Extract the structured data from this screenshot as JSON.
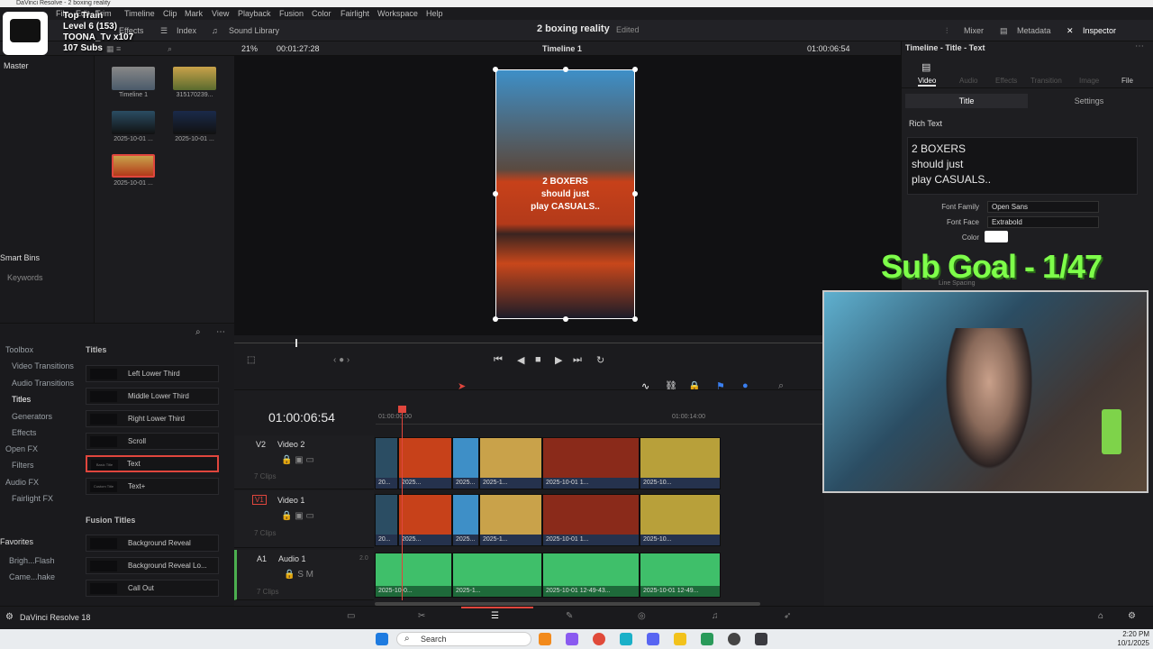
{
  "window_title": "DaVinci Resolve - 2 boxing reality",
  "menu": [
    "File",
    "Edit",
    "Trim",
    "Timeline",
    "Clip",
    "Mark",
    "View",
    "Playback",
    "Fusion",
    "Color",
    "Fairlight",
    "Workspace",
    "Help"
  ],
  "toolbar": {
    "effects": "Effects",
    "index": "Index",
    "sound_library": "Sound Library",
    "project_name": "2 boxing reality",
    "edited": "Edited",
    "mixer": "Mixer",
    "metadata": "Metadata",
    "inspector": "Inspector"
  },
  "subbar": {
    "zoom": "21%",
    "source_tc": "00:01:27:28",
    "timeline_name": "Timeline 1",
    "record_tc": "01:00:06:54"
  },
  "media": {
    "master": "Master",
    "smart_bins": "Smart Bins",
    "keywords": "Keywords",
    "clips": [
      {
        "label": "Timeline 1"
      },
      {
        "label": "315170239..."
      },
      {
        "label": "2025-10-01 ..."
      },
      {
        "label": "2025-10-01 ..."
      },
      {
        "label": "2025-10-01 ..."
      }
    ]
  },
  "viewer": {
    "overlay_text": [
      "2 BOXERS",
      "should just",
      "play CASUALS.."
    ]
  },
  "effects_lib": {
    "categories": [
      "Toolbox",
      "Video Transitions",
      "Audio Transitions",
      "Titles",
      "Generators",
      "Effects",
      "Open FX",
      "Filters",
      "Audio FX",
      "Fairlight FX",
      "Favorites",
      "Brigh...Flash",
      "Came...hake"
    ],
    "titles_header": "Titles",
    "titles": [
      "Left Lower Third",
      "Middle Lower Third",
      "Right Lower Third",
      "Scroll",
      "Text",
      "Text+"
    ],
    "title_thumbs": [
      "",
      "",
      "",
      "",
      "Basic Title",
      "Custom Title"
    ],
    "fusion_header": "Fusion Titles",
    "fusion": [
      "Background Reveal",
      "Background Reveal Lo...",
      "Call Out"
    ]
  },
  "timeline": {
    "timecode": "01:00:06:54",
    "ruler_start": "01:00:00:00",
    "ruler_mid": "01:00:14:00",
    "tracks": [
      {
        "id": "V2",
        "name": "Video 2",
        "clips": "7 Clips"
      },
      {
        "id": "V1",
        "name": "Video 1",
        "clips": "7 Clips"
      },
      {
        "id": "A1",
        "name": "Audio 1",
        "clips": "7 Clips",
        "level": "2.0"
      }
    ],
    "v_clip_labels": [
      "20...",
      "2025...",
      "2025...",
      "2025-1...",
      "2025-10-01 1...",
      "2025-10..."
    ],
    "a_clip_labels": [
      "2025-10-0...",
      "2025-1...",
      "2025-10-01 12-49-43...",
      "2025-10-01 12-49..."
    ]
  },
  "inspector": {
    "header": "Timeline - Title - Text",
    "tabs": [
      "Video",
      "Audio",
      "Effects",
      "Transition",
      "Image",
      "File"
    ],
    "subtabs": [
      "Title",
      "Settings"
    ],
    "section": "Rich Text",
    "rich_text": [
      "2 BOXERS",
      "should just",
      "play CASUALS.."
    ],
    "font_family_label": "Font Family",
    "font_family": "Open Sans",
    "font_face_label": "Font Face",
    "font_face": "Extrabold",
    "color_label": "Color",
    "line_spacing": "Line Spacing"
  },
  "stream": {
    "sub_goal": "Sub Goal - 1/47",
    "train": [
      "Top Train",
      "Level 6  (153)",
      "TOONA_Tv x107",
      "107 Subs"
    ]
  },
  "pagebar": {
    "app": "DaVinci Resolve 18"
  },
  "taskbar": {
    "search": "Search",
    "time": "2:20 PM",
    "date": "10/1/2025"
  }
}
